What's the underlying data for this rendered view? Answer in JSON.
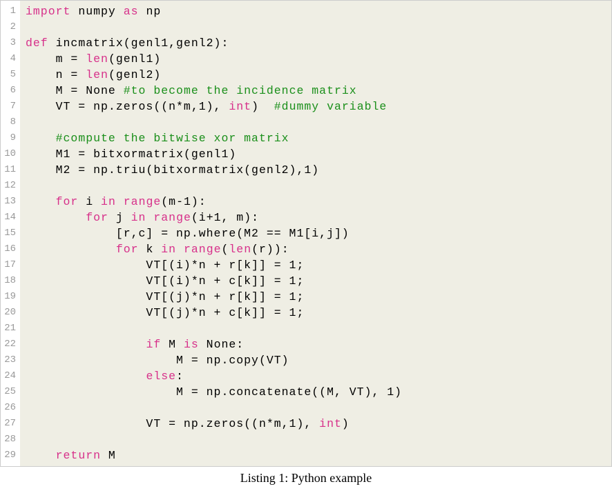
{
  "caption": "Listing 1: Python example",
  "lines": [
    {
      "num": 1,
      "tokens": [
        {
          "class": "keyword",
          "text": "import"
        },
        {
          "class": "plain",
          "text": " numpy "
        },
        {
          "class": "keyword",
          "text": "as"
        },
        {
          "class": "plain",
          "text": " np"
        }
      ]
    },
    {
      "num": 2,
      "tokens": []
    },
    {
      "num": 3,
      "tokens": [
        {
          "class": "keyword",
          "text": "def"
        },
        {
          "class": "plain",
          "text": " incmatrix(genl1,genl2):"
        }
      ]
    },
    {
      "num": 4,
      "tokens": [
        {
          "class": "plain",
          "text": "    m = "
        },
        {
          "class": "builtin",
          "text": "len"
        },
        {
          "class": "plain",
          "text": "(genl1)"
        }
      ]
    },
    {
      "num": 5,
      "tokens": [
        {
          "class": "plain",
          "text": "    n = "
        },
        {
          "class": "builtin",
          "text": "len"
        },
        {
          "class": "plain",
          "text": "(genl2)"
        }
      ]
    },
    {
      "num": 6,
      "tokens": [
        {
          "class": "plain",
          "text": "    M = None "
        },
        {
          "class": "comment",
          "text": "#to become the incidence matrix"
        }
      ]
    },
    {
      "num": 7,
      "tokens": [
        {
          "class": "plain",
          "text": "    VT = np.zeros((n*m,1), "
        },
        {
          "class": "builtin",
          "text": "int"
        },
        {
          "class": "plain",
          "text": ")  "
        },
        {
          "class": "comment",
          "text": "#dummy variable"
        }
      ]
    },
    {
      "num": 8,
      "tokens": []
    },
    {
      "num": 9,
      "tokens": [
        {
          "class": "plain",
          "text": "    "
        },
        {
          "class": "comment",
          "text": "#compute the bitwise xor matrix"
        }
      ]
    },
    {
      "num": 10,
      "tokens": [
        {
          "class": "plain",
          "text": "    M1 = bitxormatrix(genl1)"
        }
      ]
    },
    {
      "num": 11,
      "tokens": [
        {
          "class": "plain",
          "text": "    M2 = np.triu(bitxormatrix(genl2),1)"
        }
      ]
    },
    {
      "num": 12,
      "tokens": []
    },
    {
      "num": 13,
      "tokens": [
        {
          "class": "plain",
          "text": "    "
        },
        {
          "class": "keyword",
          "text": "for"
        },
        {
          "class": "plain",
          "text": " i "
        },
        {
          "class": "keyword",
          "text": "in"
        },
        {
          "class": "plain",
          "text": " "
        },
        {
          "class": "builtin",
          "text": "range"
        },
        {
          "class": "plain",
          "text": "(m-1):"
        }
      ]
    },
    {
      "num": 14,
      "tokens": [
        {
          "class": "plain",
          "text": "        "
        },
        {
          "class": "keyword",
          "text": "for"
        },
        {
          "class": "plain",
          "text": " j "
        },
        {
          "class": "keyword",
          "text": "in"
        },
        {
          "class": "plain",
          "text": " "
        },
        {
          "class": "builtin",
          "text": "range"
        },
        {
          "class": "plain",
          "text": "(i+1, m):"
        }
      ]
    },
    {
      "num": 15,
      "tokens": [
        {
          "class": "plain",
          "text": "            [r,c] = np.where(M2 == M1[i,j])"
        }
      ]
    },
    {
      "num": 16,
      "tokens": [
        {
          "class": "plain",
          "text": "            "
        },
        {
          "class": "keyword",
          "text": "for"
        },
        {
          "class": "plain",
          "text": " k "
        },
        {
          "class": "keyword",
          "text": "in"
        },
        {
          "class": "plain",
          "text": " "
        },
        {
          "class": "builtin",
          "text": "range"
        },
        {
          "class": "plain",
          "text": "("
        },
        {
          "class": "builtin",
          "text": "len"
        },
        {
          "class": "plain",
          "text": "(r)):"
        }
      ]
    },
    {
      "num": 17,
      "tokens": [
        {
          "class": "plain",
          "text": "                VT[(i)*n + r[k]] = 1;"
        }
      ]
    },
    {
      "num": 18,
      "tokens": [
        {
          "class": "plain",
          "text": "                VT[(i)*n + c[k]] = 1;"
        }
      ]
    },
    {
      "num": 19,
      "tokens": [
        {
          "class": "plain",
          "text": "                VT[(j)*n + r[k]] = 1;"
        }
      ]
    },
    {
      "num": 20,
      "tokens": [
        {
          "class": "plain",
          "text": "                VT[(j)*n + c[k]] = 1;"
        }
      ]
    },
    {
      "num": 21,
      "tokens": []
    },
    {
      "num": 22,
      "tokens": [
        {
          "class": "plain",
          "text": "                "
        },
        {
          "class": "keyword",
          "text": "if"
        },
        {
          "class": "plain",
          "text": " M "
        },
        {
          "class": "keyword",
          "text": "is"
        },
        {
          "class": "plain",
          "text": " None:"
        }
      ]
    },
    {
      "num": 23,
      "tokens": [
        {
          "class": "plain",
          "text": "                    M = np.copy(VT)"
        }
      ]
    },
    {
      "num": 24,
      "tokens": [
        {
          "class": "plain",
          "text": "                "
        },
        {
          "class": "keyword",
          "text": "else"
        },
        {
          "class": "plain",
          "text": ":"
        }
      ]
    },
    {
      "num": 25,
      "tokens": [
        {
          "class": "plain",
          "text": "                    M = np.concatenate((M, VT), 1)"
        }
      ]
    },
    {
      "num": 26,
      "tokens": []
    },
    {
      "num": 27,
      "tokens": [
        {
          "class": "plain",
          "text": "                VT = np.zeros((n*m,1), "
        },
        {
          "class": "builtin",
          "text": "int"
        },
        {
          "class": "plain",
          "text": ")"
        }
      ]
    },
    {
      "num": 28,
      "tokens": []
    },
    {
      "num": 29,
      "tokens": [
        {
          "class": "plain",
          "text": "    "
        },
        {
          "class": "keyword",
          "text": "return"
        },
        {
          "class": "plain",
          "text": " M"
        }
      ]
    }
  ]
}
